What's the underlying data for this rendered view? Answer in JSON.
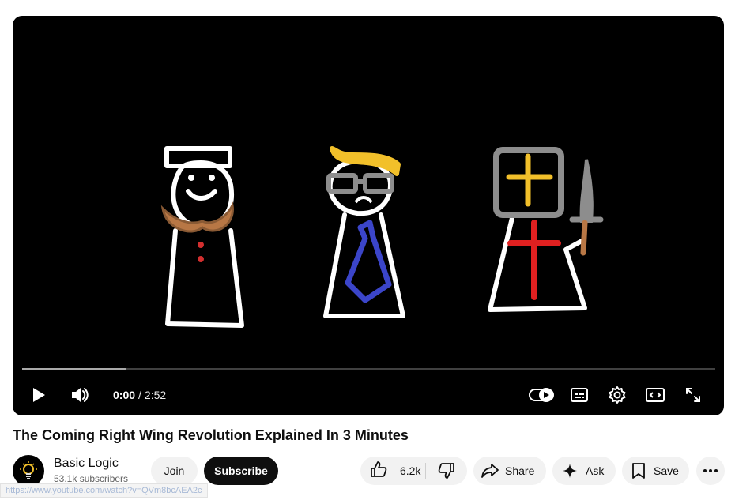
{
  "player": {
    "current_time": "0:00",
    "separator": "/",
    "duration": "2:52",
    "buffered_fraction": 0.15,
    "autoplay_on": true,
    "icons": [
      "play-icon",
      "volume-icon",
      "autoplay-toggle-icon",
      "subtitles-icon",
      "settings-gear-icon",
      "miniplayer-icon",
      "fullscreen-icon"
    ]
  },
  "video": {
    "title": "The Coming Right Wing Revolution Explained In 3 Minutes"
  },
  "channel": {
    "name": "Basic Logic",
    "subscribers": "53.1k subscribers",
    "join_label": "Join",
    "subscribe_label": "Subscribe"
  },
  "actions": {
    "like_count": "6.2k",
    "share_label": "Share",
    "ask_label": "Ask",
    "save_label": "Save"
  },
  "status_bar": {
    "url": "https://www.youtube.com/watch?v=QVm8bcAEA2c"
  },
  "colors": {
    "player_bg": "#000000",
    "subscribe_bg": "#0f0f0f",
    "pill_bg": "#f2f2f2"
  }
}
